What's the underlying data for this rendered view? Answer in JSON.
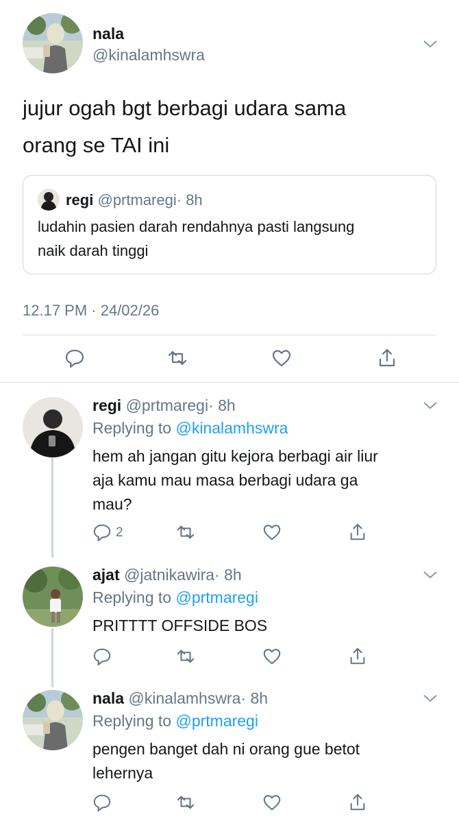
{
  "main_tweet": {
    "author_name": "nala",
    "author_handle": "@kinalamhswra",
    "text_line1": "jujur ogah bgt berbagi udara sama",
    "text_line2": "orang se TAI ini",
    "quoted": {
      "author_name": "regi",
      "author_handle": "@prtmaregi",
      "time": "· 8h",
      "text_line1": "ludahin pasien darah rendahnya pasti langsung",
      "text_line2": "naik darah tinggi"
    },
    "timestamp": "12.17 PM · 24/02/26"
  },
  "replies": [
    {
      "author_name": "regi",
      "author_handle": "@prtmaregi",
      "time": "· 8h",
      "replying_prefix": "Replying to",
      "replying_to": "@kinalamhswra",
      "text_lines": [
        "hem ah jangan gitu kejora berbagi air liur",
        "aja kamu mau masa berbagi udara ga",
        "mau?"
      ],
      "reply_count": "2"
    },
    {
      "author_name": "ajat",
      "author_handle": "@jatnikawira",
      "time": "· 8h",
      "replying_prefix": "Replying to",
      "replying_to": "@prtmaregi",
      "text_lines": [
        "PRITTTT OFFSIDE BOS"
      ]
    },
    {
      "author_name": "nala",
      "author_handle": "@kinalamhswra",
      "time": "· 8h",
      "replying_prefix": "Replying to",
      "replying_to": "@prtmaregi",
      "text_lines": [
        "pengen banget dah ni orang gue betot",
        "lehernya"
      ]
    }
  ],
  "colors": {
    "text": "#14171a",
    "secondary": "#657786",
    "link": "#1da1f2",
    "divider": "#d9dee3",
    "thread_line": "#ccd6dd"
  }
}
